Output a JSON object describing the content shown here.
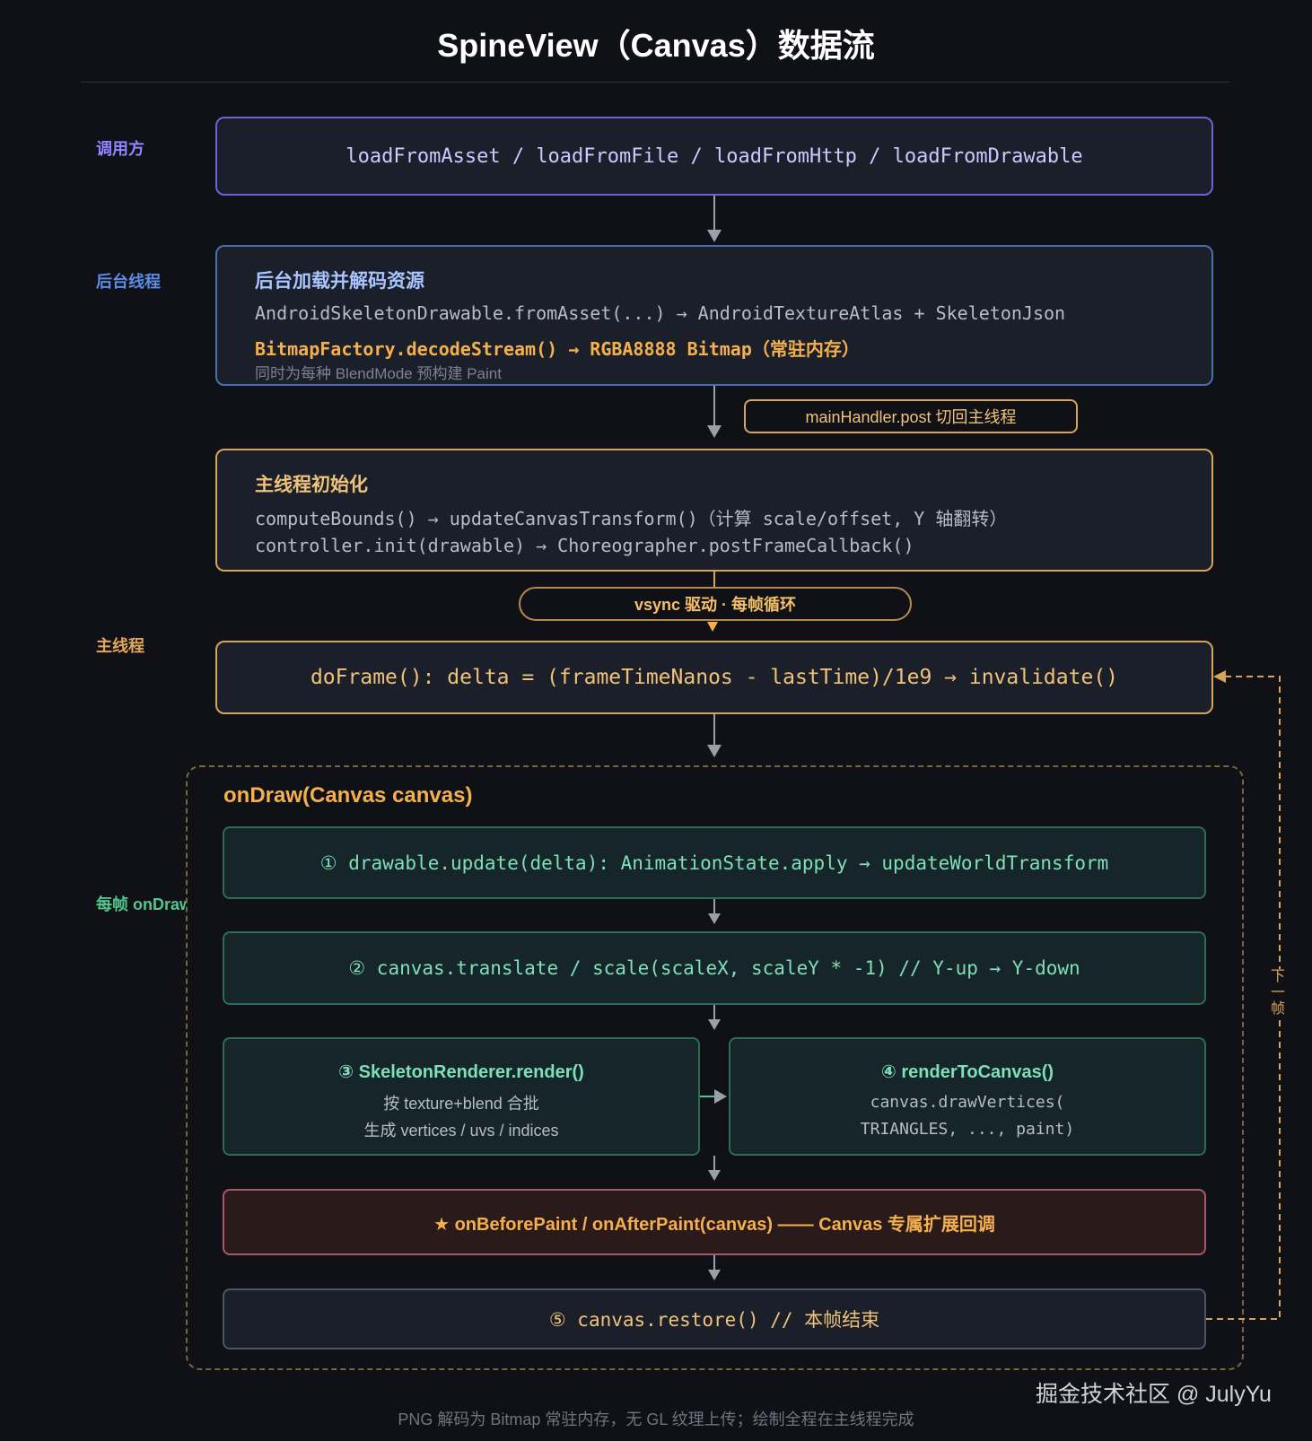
{
  "title": "SpineView（Canvas）数据流",
  "lanes": {
    "caller": "调用方",
    "background": "后台线程",
    "main": "主线程",
    "per_frame": "每帧 onDraw"
  },
  "caller_box": {
    "text": "loadFromAsset / loadFromFile / loadFromHttp / loadFromDrawable"
  },
  "bg_box": {
    "heading": "后台加载并解码资源",
    "line1": "AndroidSkeletonDrawable.fromAsset(...) → AndroidTextureAtlas + SkeletonJson",
    "line2": "BitmapFactory.decodeStream() → RGBA8888 Bitmap（常驻内存）",
    "line3": "同时为每种 BlendMode 预构建 Paint"
  },
  "handler_pill": "mainHandler.post 切回主线程",
  "init_box": {
    "heading": "主线程初始化",
    "line1": "computeBounds() → updateCanvasTransform()（计算 scale/offset, Y 轴翻转）",
    "line2": "controller.init(drawable) → Choreographer.postFrameCallback()"
  },
  "vsync_pill": "vsync 驱动 · 每帧循环",
  "doframe_box": {
    "text": "doFrame(): delta = (frameTimeNanos - lastTime)/1e9 → invalidate()"
  },
  "ondraw": {
    "title": "onDraw(Canvas canvas)",
    "step1": "① drawable.update(delta): AnimationState.apply → updateWorldTransform",
    "step2": "② canvas.translate / scale(scaleX, scaleY * -1) // Y-up → Y-down",
    "step3": {
      "heading": "③ SkeletonRenderer.render()",
      "line1": "按 texture+blend 合批",
      "line2": "生成 vertices / uvs / indices"
    },
    "step4": {
      "heading": "④ renderToCanvas()",
      "line1": "canvas.drawVertices(",
      "line2": "TRIANGLES, ..., paint)"
    },
    "hook": "★ onBeforePaint / onAfterPaint(canvas) —— Canvas 专属扩展回调",
    "step5": "⑤ canvas.restore() // 本帧结束"
  },
  "loop_label": "下一帧",
  "watermark": "掘金技术社区 @ JulyYu",
  "footer": "PNG 解码为 Bitmap 常驻内存，无 GL 纹理上传；绘制全程在主线程完成",
  "colors": {
    "background": "#0f1116",
    "caller": "#6b63d6",
    "background_thread": "#4a6fb0",
    "main_thread": "#d8a35a",
    "per_frame": "#4fc88f",
    "hook": "#e06b8f"
  }
}
